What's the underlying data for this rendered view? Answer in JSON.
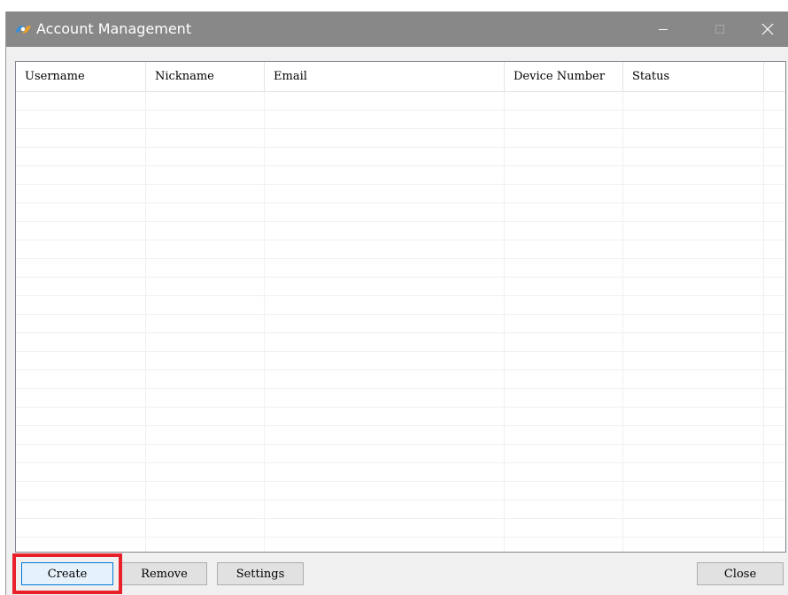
{
  "window": {
    "title": "Account Management",
    "title_bar_color": "#888888",
    "icon": "app-logo-icon",
    "controls": [
      "minimize-icon",
      "maximize-icon",
      "close-icon"
    ]
  },
  "table": {
    "columns": [
      "Username",
      "Nickname",
      "Email",
      "Device Number",
      "Status"
    ],
    "rows": []
  },
  "buttons": {
    "create": "Create",
    "remove": "Remove",
    "settings": "Settings",
    "close": "Close"
  },
  "highlight": {
    "target": "create-button",
    "color": "#e8202a"
  }
}
